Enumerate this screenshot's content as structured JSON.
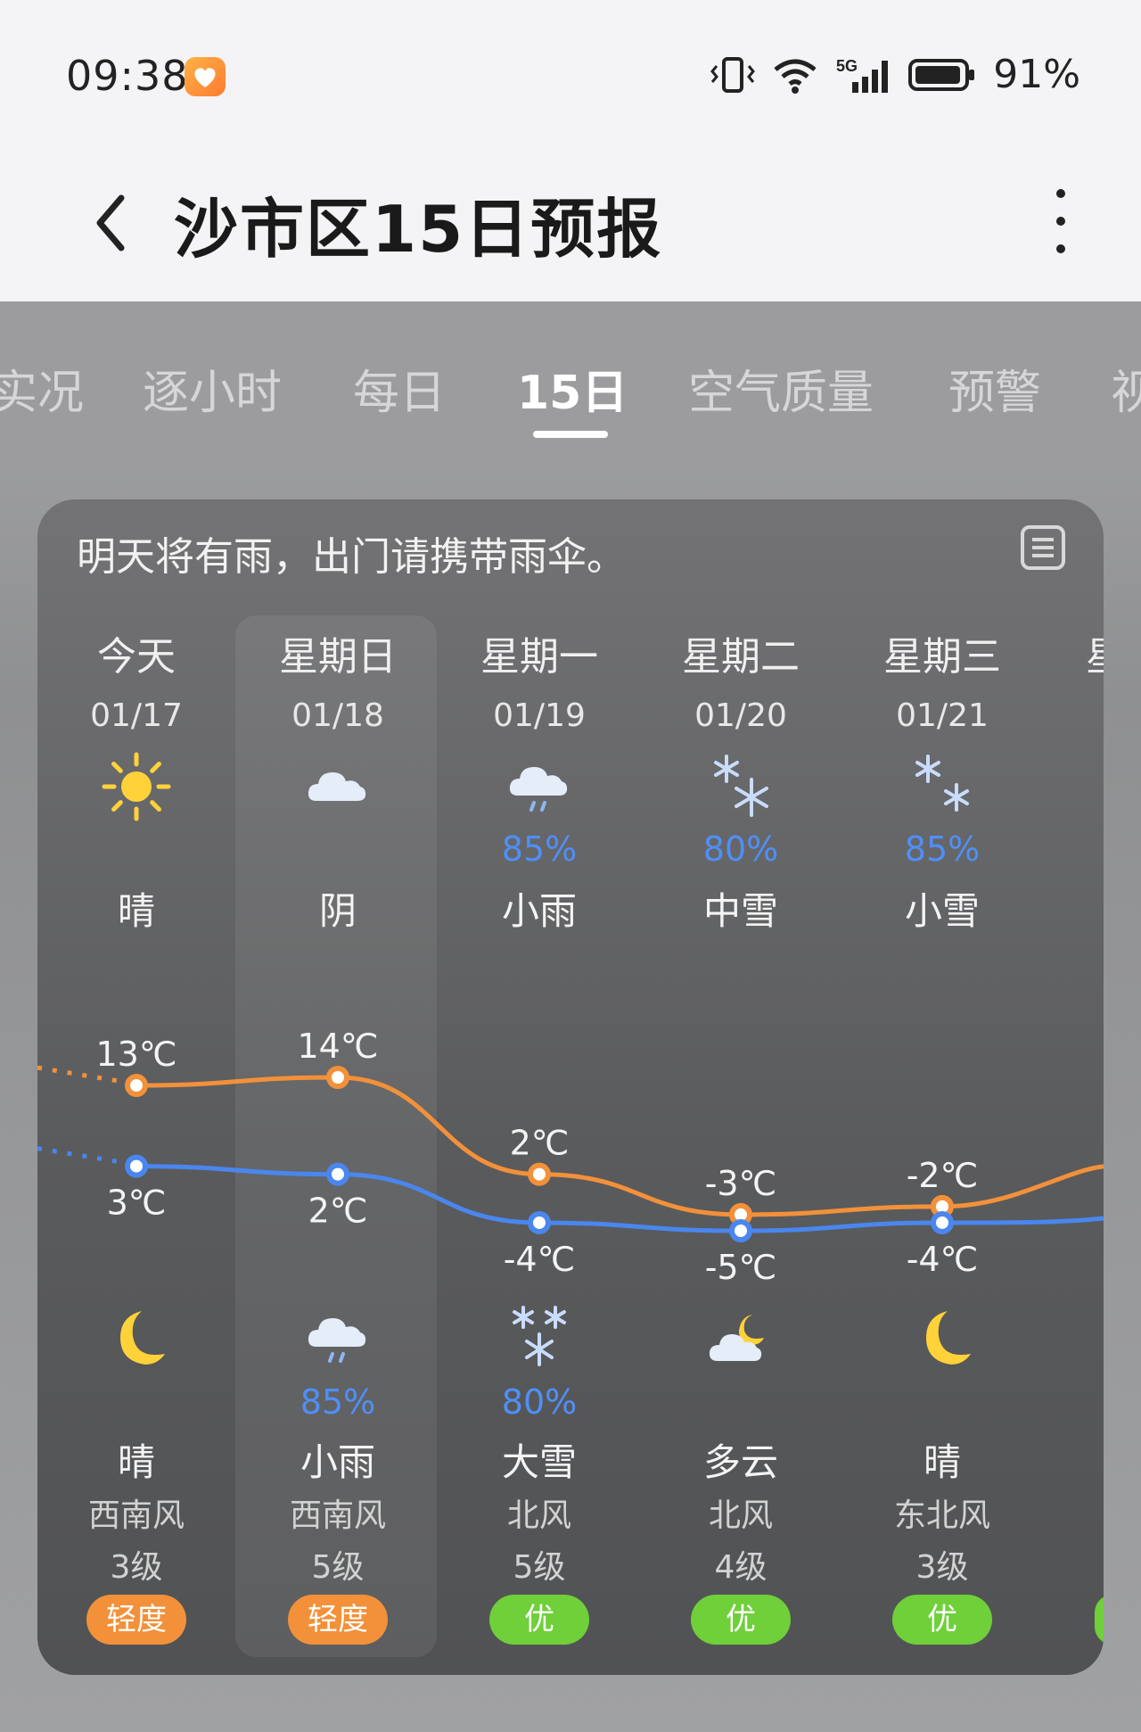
{
  "status": {
    "time": "09:38",
    "battery": "91%",
    "network": "5G"
  },
  "header": {
    "title": "沙市区15日预报"
  },
  "tabs": [
    {
      "label": "实况",
      "active": false
    },
    {
      "label": "逐小时",
      "active": false
    },
    {
      "label": "每日",
      "active": false
    },
    {
      "label": "15日",
      "active": true
    },
    {
      "label": "空气质量",
      "active": false
    },
    {
      "label": "预警",
      "active": false
    },
    {
      "label": "视",
      "active": false
    }
  ],
  "card": {
    "summary": "明天将有雨，出门请携带雨伞。",
    "partial_next_weekday": "星",
    "days": [
      {
        "weekday": "今天",
        "date": "01/17",
        "day_icon": "sun-icon",
        "day_prob": "",
        "day_cond": "晴",
        "high": "13℃",
        "low": "3℃",
        "night_icon": "moon-icon",
        "night_prob": "",
        "night_cond": "晴",
        "wind_dir": "西南风",
        "wind_level": "3级",
        "aqi": "轻度",
        "aqi_color": "#f2913a"
      },
      {
        "weekday": "星期日",
        "date": "01/18",
        "day_icon": "cloud-icon",
        "day_prob": "",
        "day_cond": "阴",
        "high": "14℃",
        "low": "2℃",
        "night_icon": "rain-cloud-icon",
        "night_prob": "85%",
        "night_cond": "小雨",
        "wind_dir": "西南风",
        "wind_level": "5级",
        "aqi": "轻度",
        "aqi_color": "#f2913a"
      },
      {
        "weekday": "星期一",
        "date": "01/19",
        "day_icon": "rain-cloud-icon",
        "day_prob": "85%",
        "day_cond": "小雨",
        "high": "2℃",
        "low": "-4℃",
        "night_icon": "snow-heavy-icon",
        "night_prob": "80%",
        "night_cond": "大雪",
        "wind_dir": "北风",
        "wind_level": "5级",
        "aqi": "优",
        "aqi_color": "#6fd03a"
      },
      {
        "weekday": "星期二",
        "date": "01/20",
        "day_icon": "snow-medium-icon",
        "day_prob": "80%",
        "day_cond": "中雪",
        "high": "-3℃",
        "low": "-5℃",
        "night_icon": "cloudy-night-icon",
        "night_prob": "",
        "night_cond": "多云",
        "wind_dir": "北风",
        "wind_level": "4级",
        "aqi": "优",
        "aqi_color": "#6fd03a"
      },
      {
        "weekday": "星期三",
        "date": "01/21",
        "day_icon": "snow-light-icon",
        "day_prob": "85%",
        "day_cond": "小雪",
        "high": "-2℃",
        "low": "-4℃",
        "night_icon": "moon-icon",
        "night_prob": "",
        "night_cond": "晴",
        "wind_dir": "东北风",
        "wind_level": "3级",
        "aqi": "优",
        "aqi_color": "#6fd03a"
      }
    ]
  },
  "chart_data": {
    "type": "line",
    "x": [
      "01/17",
      "01/18",
      "01/19",
      "01/20",
      "01/21"
    ],
    "series": [
      {
        "values": [
          13,
          14,
          2,
          -3,
          -2
        ],
        "color": "#f2913a"
      },
      {
        "values": [
          3,
          2,
          -4,
          -5,
          -4
        ],
        "color": "#4a86ee"
      }
    ]
  }
}
